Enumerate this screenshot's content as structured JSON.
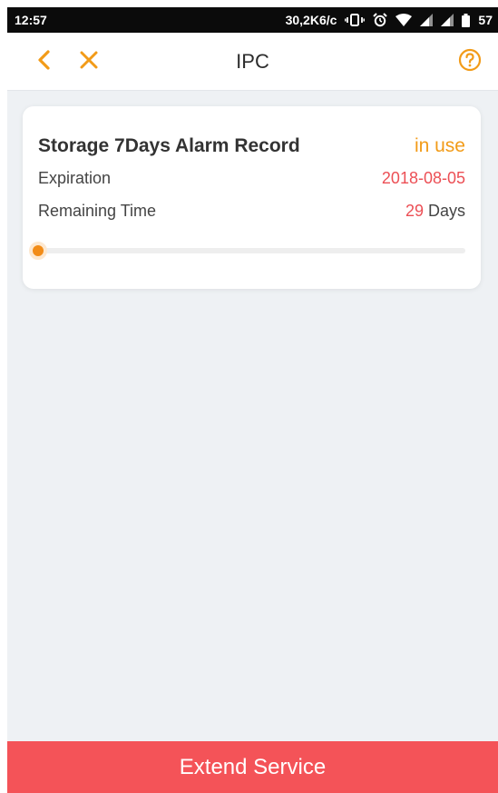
{
  "status_bar": {
    "time": "12:57",
    "network_speed": "30,2K6/c",
    "battery": "57",
    "icons": [
      "vibrate-icon",
      "alarm-icon",
      "wifi-icon",
      "signal-icon",
      "signal-icon",
      "battery-icon"
    ]
  },
  "header": {
    "title": "IPC",
    "back_icon": "back-chevron-icon",
    "close_icon": "close-icon",
    "help_icon": "help-icon"
  },
  "service_card": {
    "plan_name": "Storage 7Days Alarm Record",
    "status": "in use",
    "expiration_label": "Expiration",
    "expiration_value": "2018-08-05",
    "remaining_label": "Remaining Time",
    "remaining_value": "29",
    "remaining_unit": " Days",
    "progress": 0.0
  },
  "footer": {
    "extend_label": "Extend Service"
  },
  "colors": {
    "accent": "#f29b18",
    "danger": "#ec4f55",
    "button": "#f45358",
    "background": "#eef1f4"
  }
}
